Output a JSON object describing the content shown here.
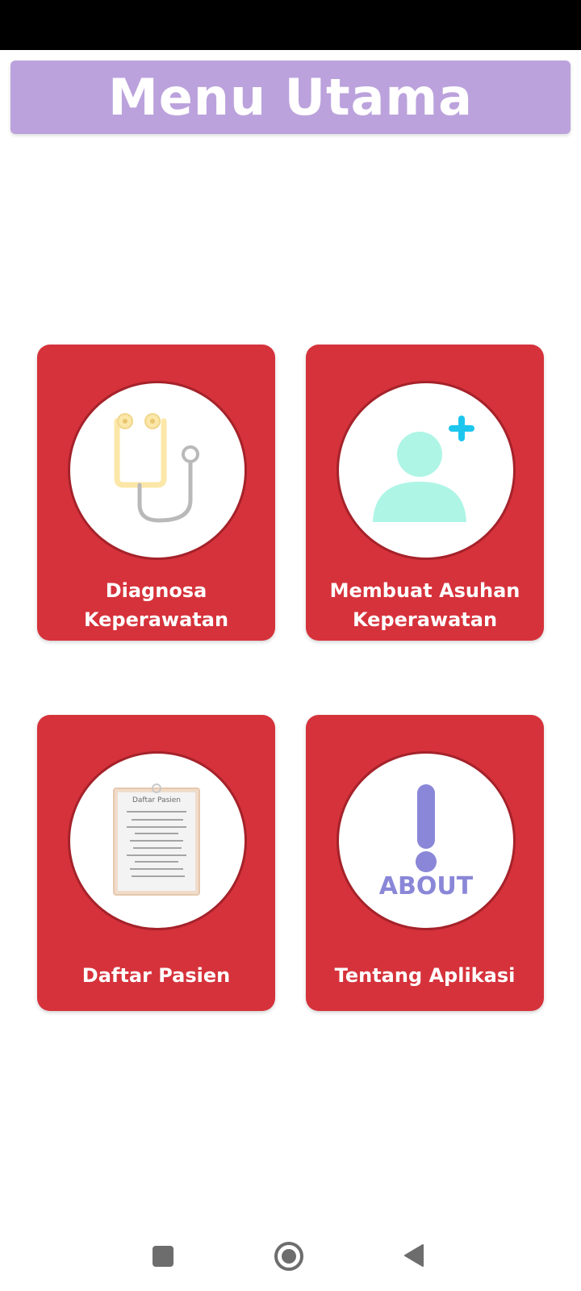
{
  "header": {
    "title": "Menu Utama"
  },
  "menu": [
    {
      "id": "diagnosa",
      "label_line1": "Diagnosa",
      "label_line2": "Keperawatan",
      "icon": "stethoscope-icon"
    },
    {
      "id": "asuhan",
      "label_line1": "Membuat Asuhan",
      "label_line2": "Keperawatan",
      "icon": "add-user-icon"
    },
    {
      "id": "pasien",
      "label_line1": "Daftar Pasien",
      "icon": "clipboard-icon",
      "icon_text": "Daftar Pasien"
    },
    {
      "id": "tentang",
      "label_line1": "Tentang Aplikasi",
      "icon": "about-icon",
      "icon_text": "ABOUT"
    }
  ],
  "colors": {
    "header_bg": "#bba2dc",
    "card_bg": "#d6323b",
    "circle_border": "#a5222a",
    "about_icon": "#8a87d8",
    "user_icon": "#aef5e6",
    "plus_icon": "#1ec6ee"
  },
  "navigation": {
    "recents": "recents-icon",
    "home": "home-icon",
    "back": "back-icon"
  }
}
